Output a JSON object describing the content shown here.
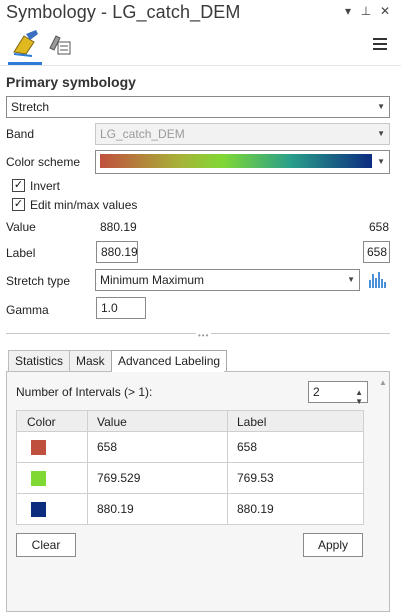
{
  "window": {
    "title": "Symbology - LG_catch_DEM",
    "buttons": {
      "dropdown": "▾",
      "pin": "⊥",
      "close": "✕"
    }
  },
  "icon_tabs": [
    "primary-symbology-brush-icon",
    "secondary-symbology-icon"
  ],
  "section_title": "Primary symbology",
  "renderer": {
    "selected": "Stretch"
  },
  "band": {
    "label": "Band",
    "value": "LG_catch_DEM"
  },
  "color_scheme": {
    "label": "Color scheme",
    "colors": [
      "#c0503e",
      "#80d834",
      "#0c2c80"
    ]
  },
  "checkboxes": [
    {
      "label": "Invert",
      "checked": true
    },
    {
      "label": "Edit min/max values",
      "checked": true
    }
  ],
  "value_row": {
    "label": "Value",
    "min": "880.19",
    "max": "658"
  },
  "label_row": {
    "label": "Label",
    "min": "880.19",
    "max": "658"
  },
  "stretch_type": {
    "label": "Stretch type",
    "selected": "Minimum Maximum"
  },
  "gamma": {
    "label": "Gamma",
    "value": "1.0"
  },
  "tabs": [
    {
      "label": "Statistics",
      "active": false
    },
    {
      "label": "Mask",
      "active": false
    },
    {
      "label": "Advanced Labeling",
      "active": true
    }
  ],
  "intervals": {
    "label": "Number of Intervals (> 1):",
    "value": "2"
  },
  "table": {
    "headers": [
      "Color",
      "Value",
      "Label"
    ],
    "rows": [
      {
        "color": "#c0503e",
        "value": "658",
        "label": "658"
      },
      {
        "color": "#80d834",
        "value": "769.529",
        "label": "769.53"
      },
      {
        "color": "#0c2c80",
        "value": "880.19",
        "label": "880.19"
      }
    ]
  },
  "buttons": {
    "clear": "Clear",
    "apply": "Apply"
  }
}
